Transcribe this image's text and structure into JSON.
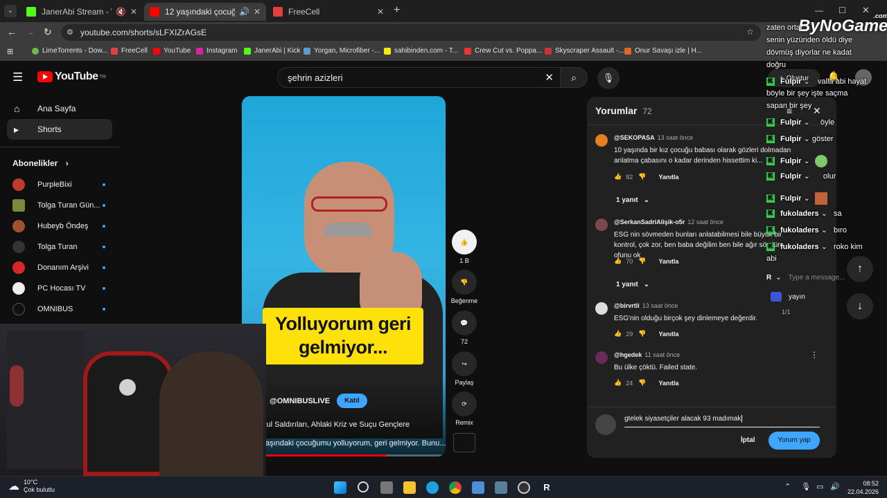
{
  "browser": {
    "tabs": [
      {
        "label": "JanerAbi Stream - Watch Li",
        "active": false
      },
      {
        "label": "12 yaşındaki çocuğumu yoll",
        "active": true
      },
      {
        "label": "FreeCell",
        "active": false
      }
    ],
    "url": "youtube.com/shorts/sLFXIZrAGsE",
    "bookmarks": [
      "LimeTorrents - Dow...",
      "FreeCell",
      "YouTube",
      "Instagram",
      "JanerAbi | Kick",
      "Yorgan, Microfiber -...",
      "sahibinden.com - T...",
      "Crew Cut vs. Poppa...",
      "Skyscraper Assault -...",
      "Onur Savaşı izle | H..."
    ]
  },
  "youtube": {
    "logo": "YouTube",
    "region": "TR",
    "search_query": "şehrin azizleri",
    "create_label": "Oluştur",
    "nav": [
      {
        "label": "Ana Sayfa",
        "icon": "home-icon"
      },
      {
        "label": "Shorts",
        "icon": "shorts-icon"
      }
    ],
    "subscriptions_title": "Abonelikler",
    "subscriptions": [
      "PurpleBixi",
      "Tolga Turan Gün...",
      "Hubeyb Öndeş",
      "Tolga Turan",
      "Donanım Arşivi",
      "PC Hocası TV",
      "OMNIBUS"
    ],
    "short": {
      "caption_line1": "Yolluyorum geri",
      "caption_line2": "gelmiyor...",
      "channel": "@OMNIBUSLIVE",
      "join_label": "Katıl",
      "title_line1": "kul Saldırıları, Ahlaki Kriz ve Suçu Gençlere",
      "title_line2": "aşındaki çocuğumu yolluyorum, geri gelmiyor. Bunu..."
    },
    "actions": {
      "like_count": "1 B",
      "dislike_label": "Beğenme",
      "comment_count": "72",
      "share_label": "Paylaş",
      "remix_label": "Remix"
    },
    "comments": {
      "title": "Yorumlar",
      "count": "72",
      "items": [
        {
          "author": "@SEKOPASA",
          "time": "13 saat önce",
          "text": "10 yaşında bir kız çocuğu babası olarak gözleri dolmadan anlatma çabasını o kadar derinden hissettim ki...",
          "likes": "82",
          "reply_label": "Yanıtla",
          "replies": "1 yanıt"
        },
        {
          "author": "@SerkanSadriAlişik-o5r",
          "time": "12 saat önce",
          "text": "ESG nin sövmeden bunları anlatabilmesi bile büyük bir kontrol, çok zor, ben baba değilim ben bile ağır sövdüm ... ofunu ok",
          "likes": "70",
          "reply_label": "Yanıtla",
          "replies": "1 yanıt"
        },
        {
          "author": "@birvrtli",
          "time": "13 saat önce",
          "text": "ESG'nin olduğu birçok şey dinlemeye değerdir.",
          "likes": "29",
          "reply_label": "Yanıtla",
          "replies": ""
        },
        {
          "author": "@hgedek",
          "time": "11 saat önce",
          "text": "Bu ülke çöktü. Failed state.",
          "likes": "24",
          "reply_label": "Yanıtla",
          "replies": ""
        }
      ],
      "input_value": "gtelek siyasetçiler alacak 93 madımak",
      "cancel_label": "İptal",
      "submit_label": "Yorum yap"
    }
  },
  "overlay": {
    "watermark": "ByNoGame",
    "watermark_sub": ".com",
    "chat": [
      {
        "user": "",
        "text": "zaten orta"
      },
      {
        "user": "",
        "text": "senin yüzünden öldü diye"
      },
      {
        "user": "",
        "text": "dövmüş diyorlar ne kadat"
      },
      {
        "user": "",
        "text": "doğru"
      },
      {
        "user": "Fulpir",
        "text": "valla abi hayat"
      },
      {
        "user": "",
        "text": "böyle bir şey işte saçma"
      },
      {
        "user": "",
        "text": "sapan bir şey"
      },
      {
        "user": "Fulpir",
        "text": "öyle"
      },
      {
        "user": "Fulpir",
        "text": "göster"
      },
      {
        "user": "Fulpir",
        "text": ""
      },
      {
        "user": "Fulpir",
        "text": "olur"
      },
      {
        "user": "Fulpir",
        "text": ""
      },
      {
        "user": "fukoladers",
        "text": "sa"
      },
      {
        "user": "fukoladers",
        "text": "bıro"
      },
      {
        "user": "fukoladers",
        "text": "roko kim"
      },
      {
        "user": "",
        "text": "abi"
      }
    ],
    "chat_input_placeholder": "Type a message...",
    "chat_badge": "R",
    "viewer_label": "yayın",
    "page_indicator": "1/1"
  },
  "taskbar": {
    "weather_temp": "10°C",
    "weather_desc": "Çok bulutlu",
    "time": "08:52",
    "date": "22.04.2026"
  }
}
